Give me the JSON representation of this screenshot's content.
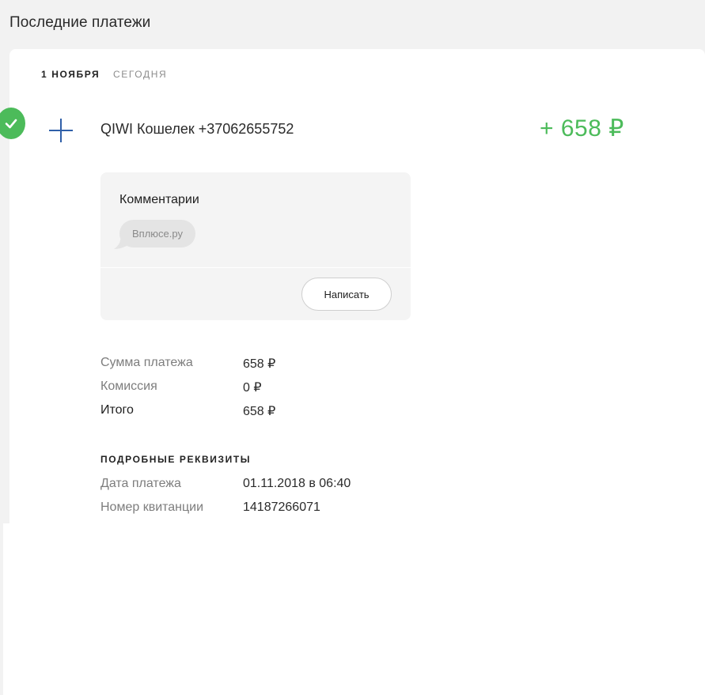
{
  "page": {
    "title": "Последние платежи"
  },
  "payment": {
    "date_main": "1 НОЯБРЯ",
    "date_sub": "СЕГОДНЯ",
    "status_icon": "check-icon",
    "type_icon": "plus-icon",
    "provider": "QIWI Кошелек +37062655752",
    "amount": "+ 658 ₽",
    "amount_color": "#4cbb5a"
  },
  "comments": {
    "title": "Комментарии",
    "items": [
      "Вплюсе.ру"
    ],
    "write_button": "Написать"
  },
  "summary": [
    {
      "label": "Сумма платежа",
      "value": "658 ₽"
    },
    {
      "label": "Комиссия",
      "value": "0 ₽"
    },
    {
      "label": "Итого",
      "value": "658 ₽"
    }
  ],
  "details": {
    "heading": "ПОДРОБНЫЕ РЕКВИЗИТЫ",
    "rows": [
      {
        "label": "Дата платежа",
        "value": "01.11.2018 в 06:40"
      },
      {
        "label": "Номер квитанции",
        "value": "14187266071"
      }
    ]
  }
}
